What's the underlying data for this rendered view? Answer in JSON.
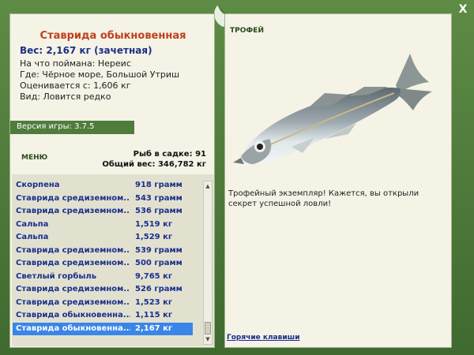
{
  "window": {
    "close_label": "X"
  },
  "fish": {
    "title": "Ставрида обыкновенная",
    "weight_line": "Вес: 2,167 кг (зачетная)",
    "bait_line": "На что поймана: Нереис",
    "location_line": "Где: Чёрное море, Большой Утриш",
    "value_line": "Оценивается с: 1,606 кг",
    "rarity_line": "Вид: Ловится редко"
  },
  "version": "Версия игры: 3.7.5",
  "menu_label": "МЕНЮ",
  "stats": {
    "fish_count": "Рыб в садке: 91",
    "total_weight": "Общий вес: 346,782 кг"
  },
  "catch_list": [
    {
      "name": "Скорпена",
      "weight": "918 грамм"
    },
    {
      "name": "Ставрида средиземном...",
      "weight": "543 грамм"
    },
    {
      "name": "Ставрида средиземном...",
      "weight": "536 грамм"
    },
    {
      "name": "Сальпа",
      "weight": "1,519 кг"
    },
    {
      "name": "Сальпа",
      "weight": "1,529 кг"
    },
    {
      "name": "Ставрида средиземном...",
      "weight": "539 грамм"
    },
    {
      "name": "Ставрида средиземном...",
      "weight": "500 грамм"
    },
    {
      "name": "Светлый горбыль",
      "weight": "9,765 кг"
    },
    {
      "name": "Ставрида средиземном...",
      "weight": "526 грамм"
    },
    {
      "name": "Ставрида средиземном...",
      "weight": "1,523 кг"
    },
    {
      "name": "Ставрида обыкновенна...",
      "weight": "1,115 кг"
    },
    {
      "name": "Ставрида обыкновенна...",
      "weight": "2,167 кг"
    }
  ],
  "selected_index": 11,
  "trophy": {
    "header": "ТРОФЕЙ",
    "text": "Трофейный экземпляр! Кажется, вы открыли секрет успешной ловли!"
  },
  "hotkeys_label": "Горячие клавиши",
  "colors": {
    "frame_green": "#4b7a3a",
    "panel_bg": "#f4f3e6",
    "title_red": "#c0401d",
    "list_blue": "#1b2f8a",
    "selection_blue": "#3a86e8"
  }
}
